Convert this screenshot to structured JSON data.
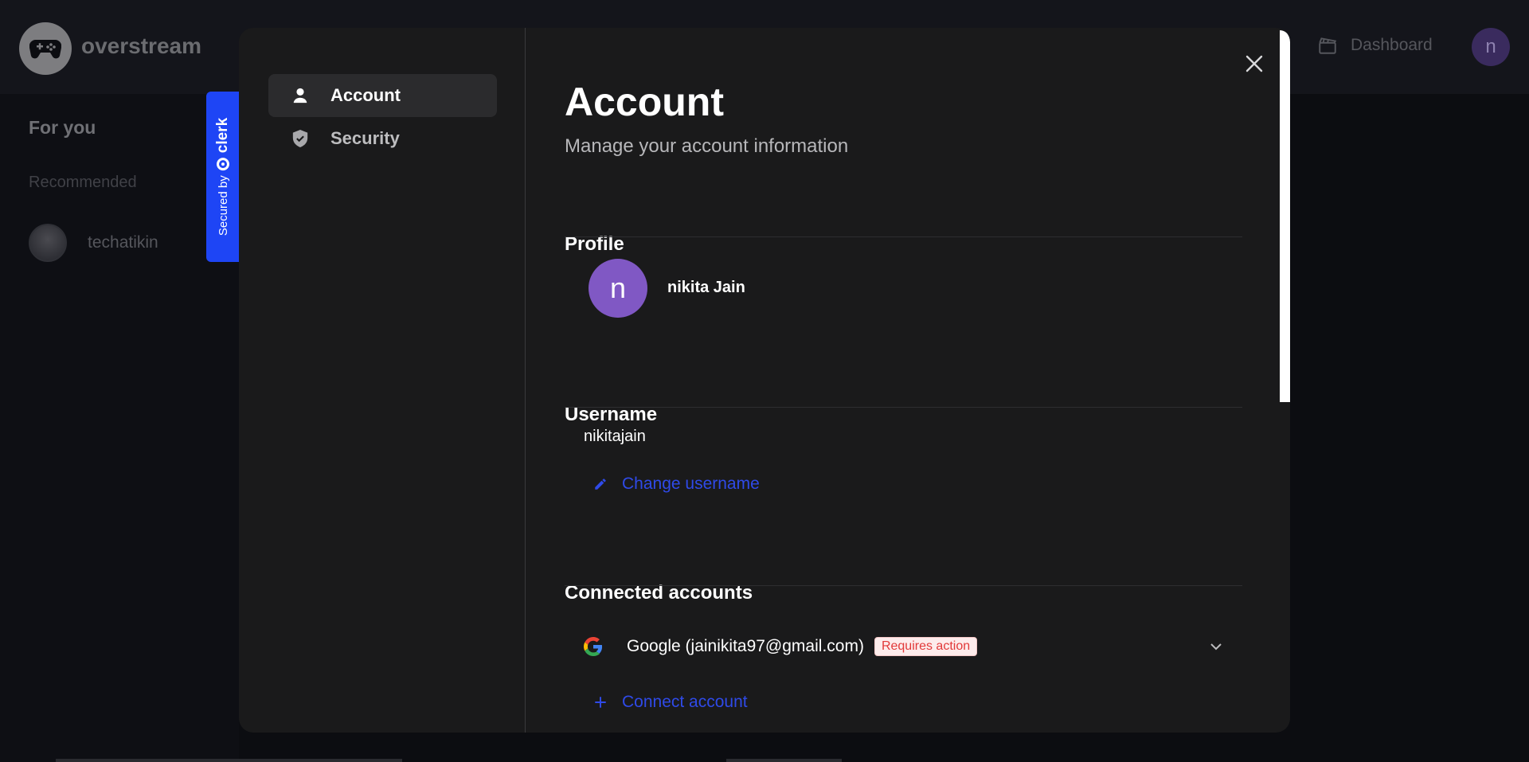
{
  "app": {
    "brand": "overstream",
    "dashboard_label": "Dashboard",
    "user_initial": "n",
    "sidebar": {
      "for_you": "For you",
      "recommended": "Recommended",
      "recommended_users": [
        {
          "name": "techatikin"
        }
      ]
    }
  },
  "clerk_badge": {
    "prefix": "Secured by",
    "brand": "clerk"
  },
  "modal": {
    "nav": [
      {
        "label": "Account",
        "icon": "user-icon",
        "active": true
      },
      {
        "label": "Security",
        "icon": "shield-icon",
        "active": false
      }
    ],
    "title": "Account",
    "subtitle": "Manage your account information",
    "profile": {
      "heading": "Profile",
      "initial": "n",
      "name": "nikita Jain"
    },
    "username": {
      "heading": "Username",
      "value": "nikitajain",
      "change_label": "Change username"
    },
    "connected": {
      "heading": "Connected accounts",
      "accounts": [
        {
          "provider_label": "Google (jainikita97@gmail.com)",
          "badge": "Requires action"
        }
      ],
      "connect_label": "Connect account"
    }
  },
  "colors": {
    "accent": "#2f4ae8",
    "clerk": "#1e45f5",
    "avatar": "#8058c4",
    "badge_text": "#e23a3a"
  }
}
